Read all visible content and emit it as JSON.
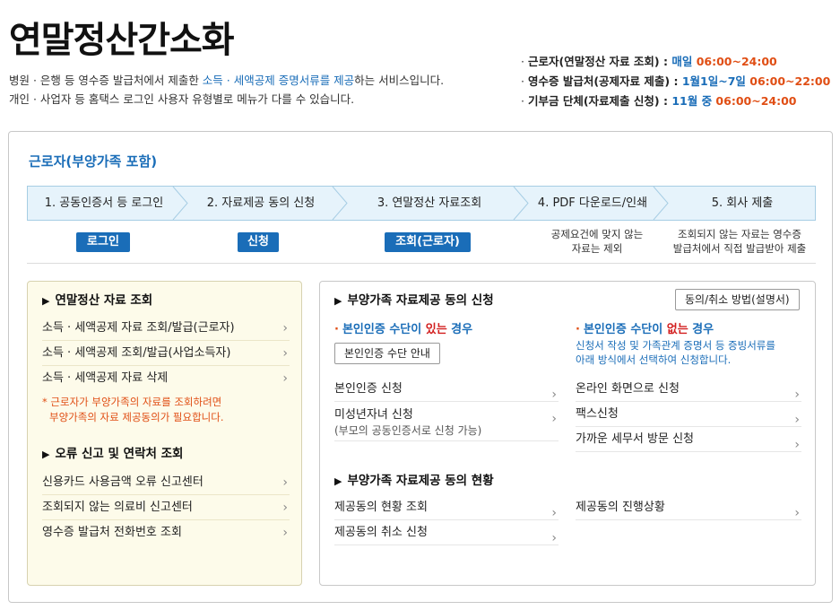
{
  "header": {
    "title": "연말정산간소화",
    "desc_line1_pre": "병원 · 은행 등 영수증 발급처에서 제출한 ",
    "desc_line1_hl": "소득 · 세액공제 증명서류를 제공",
    "desc_line1_post": "하는 서비스입니다.",
    "desc_line2": "개인 · 사업자 등 홈택스 로그인 사용자 유형별로 메뉴가 다를 수 있습니다."
  },
  "hours": [
    {
      "label": "근로자(연말정산 자료 조회) : ",
      "day": "매일",
      "time": " 06:00~24:00"
    },
    {
      "label": "영수증 발급처(공제자료 제출) : ",
      "day": "1월1일~7일",
      "time": " 06:00~22:00"
    },
    {
      "label": "기부금 단체(자료제출 신청) : ",
      "day": "11월 중",
      "time": " 06:00~24:00"
    }
  ],
  "section": {
    "title": "근로자(부양가족 포함)",
    "steps": [
      "1. 공동인증서 등 로그인",
      "2. 자료제공 동의 신청",
      "3. 연말정산 자료조회",
      "4. PDF 다운로드/인쇄",
      "5. 회사 제출"
    ],
    "actions": {
      "login": "로그인",
      "apply": "신청",
      "inquiry": "조회(근로자)",
      "note4_l1": "공제요건에 맞지 않는",
      "note4_l2": "자료는 제외",
      "note5_l1": "조회되지 않는 자료는 영수증",
      "note5_l2": "발급처에서 직접 발급받아 제출"
    }
  },
  "left_box": {
    "head1": "연말정산 자료 조회",
    "links1": [
      "소득 · 세액공제 자료 조회/발급(근로자)",
      "소득 · 세액공제 조회/발급(사업소득자)",
      "소득 · 세액공제 자료 삭제"
    ],
    "notice_l1": "* 근로자가 부양가족의 자료를 조회하려면",
    "notice_l2": "부양가족의 자료 제공동의가 필요합니다.",
    "head2": "오류 신고 및 연락처 조회",
    "links2": [
      "신용카드 사용금액 오류 신고센터",
      "조회되지 않는 의료비 신고센터",
      "영수증 발급처 전화번호 조회"
    ]
  },
  "right_box": {
    "head1": "부양가족 자료제공 동의 신청",
    "guide_btn": "동의/취소 방법(설명서)",
    "col1_head_pre": "본인인증 수단이 ",
    "col1_head_red": "있는",
    "col1_head_post": " 경우",
    "col1_btn": "본인인증 수단 안내",
    "col1_link1": "본인인증 신청",
    "col1_link2": "미성년자녀 신청",
    "col1_link2_sub": "(부모의 공동인증서로 신청 가능)",
    "col2_head_pre": "본인인증 수단이 ",
    "col2_head_red": "없는",
    "col2_head_post": " 경우",
    "col2_desc_l1": "신청서 작성 및 가족관계 증명서 등 증빙서류를",
    "col2_desc_l2": "아래 방식에서 선택하여 신청합니다.",
    "col2_links": [
      "온라인 화면으로 신청",
      "팩스신청",
      "가까운 세무서 방문 신청"
    ],
    "head2": "부양가족 자료제공 동의 현황",
    "status_links_left": [
      "제공동의 현황 조회",
      "제공동의 취소 신청"
    ],
    "status_link_right": "제공동의 진행상황"
  }
}
